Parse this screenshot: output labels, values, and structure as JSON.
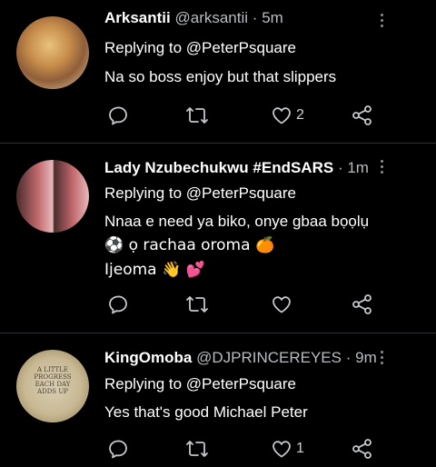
{
  "tweets": [
    {
      "name": "Arksantii",
      "handle": "@arksantii",
      "dot": "·",
      "time": "5m",
      "replying_prefix": "Replying to",
      "replying_to": "@PeterPsquare",
      "lines": [
        "Na so boss enjoy but that slippers"
      ],
      "reply_count": "",
      "retweet_count": "",
      "like_count": "2"
    },
    {
      "name": "Lady Nzubechukwu #EndSARS",
      "handle": "",
      "dot": "·",
      "time": "1m",
      "replying_prefix": "Replying to",
      "replying_to": "@PeterPsquare",
      "lines": [
        "Nnaa e need ya biko, onye gbaa bọọlụ",
        "⚽ ọ rachaa oroma 🍊",
        "Ijeoma 👋 💕"
      ],
      "reply_count": "",
      "retweet_count": "",
      "like_count": ""
    },
    {
      "name": "KingOmoba",
      "handle": "@DJPRINCEREYES",
      "dot": "·",
      "time": "9m",
      "replying_prefix": "Replying to",
      "replying_to": "@PeterPsquare",
      "lines": [
        "Yes that's good Michael Peter"
      ],
      "reply_count": "",
      "retweet_count": "",
      "like_count": "1",
      "avatar_text": "A LITTLE PROGRESS EACH DAY ADDS UP"
    }
  ],
  "icons": {
    "reply": "comment-icon",
    "retweet": "retweet-icon",
    "like": "heart-icon",
    "share": "share-icon",
    "more": "more-vertical-icon"
  },
  "colors": {
    "background": "#000000",
    "text": "#ffffff",
    "secondary": "#b8bcc0",
    "icon": "#c4c8cc",
    "divider": "#2f3336"
  }
}
